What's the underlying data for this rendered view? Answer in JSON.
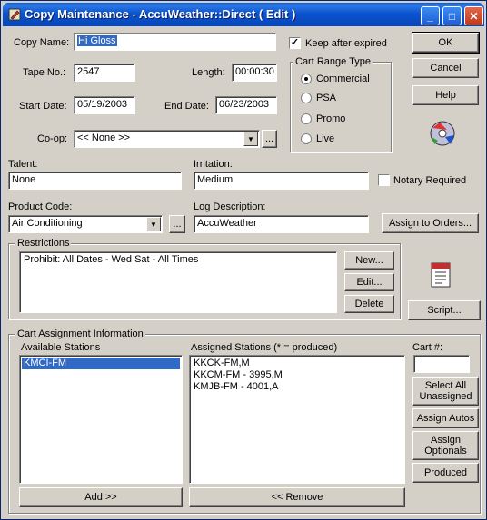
{
  "window": {
    "title": "Copy Maintenance - AccuWeather::Direct ( Edit )",
    "controls": {
      "minimize": "_",
      "maximize": "□",
      "close": "✕"
    }
  },
  "form": {
    "copy_name_label": "Copy Name:",
    "copy_name_value": "Hi Gloss",
    "keep_after_expired_label": "Keep after expired",
    "keep_after_expired_checked": "✓",
    "tape_no_label": "Tape No.:",
    "tape_no_value": "2547",
    "length_label": "Length:",
    "length_value": "00:00:30",
    "start_date_label": "Start Date:",
    "start_date_value": "05/19/2003",
    "end_date_label": "End Date:",
    "end_date_value": "06/23/2003",
    "coop_label": "Co-op:",
    "coop_value": "<< None >>",
    "ellipsis": "...",
    "talent_label": "Talent:",
    "talent_value": "None",
    "irritation_label": "Irritation:",
    "irritation_value": "Medium",
    "notary_label": "Notary Required",
    "product_code_label": "Product Code:",
    "product_code_value": "Air Conditioning",
    "log_description_label": "Log Description:",
    "log_description_value": "AccuWeather"
  },
  "cart_range": {
    "title": "Cart Range Type",
    "options": [
      "Commercial",
      "PSA",
      "Promo",
      "Live"
    ],
    "selected": "Commercial"
  },
  "buttons": {
    "ok": "OK",
    "cancel": "Cancel",
    "help": "Help",
    "assign_to_orders": "Assign to Orders...",
    "new": "New...",
    "edit": "Edit...",
    "delete": "Delete",
    "script": "Script...",
    "select_all_unassigned_1": "Select All",
    "select_all_unassigned_2": "Unassigned",
    "assign_autos": "Assign Autos",
    "assign_optionals_1": "Assign",
    "assign_optionals_2": "Optionals",
    "produced": "Produced",
    "add": "Add >>",
    "remove": "<< Remove"
  },
  "restrictions": {
    "title": "Restrictions",
    "items": [
      "Prohibit: All Dates - Wed Sat  - All Times"
    ]
  },
  "cart_assignment": {
    "title": "Cart Assignment Information",
    "available_label": "Available Stations",
    "available": [
      "KMCI-FM"
    ],
    "assigned_label": "Assigned Stations (* = produced)",
    "assigned": [
      "KKCK-FM,M",
      "KKCM-FM - 3995,M",
      "KMJB-FM - 4001,A"
    ],
    "cart_no_label": "Cart #:",
    "cart_no_value": ""
  },
  "icons": {
    "title_icon": "app-pencil-icon",
    "media_icon": "cd-media-icon",
    "script_icon": "script-document-icon"
  }
}
